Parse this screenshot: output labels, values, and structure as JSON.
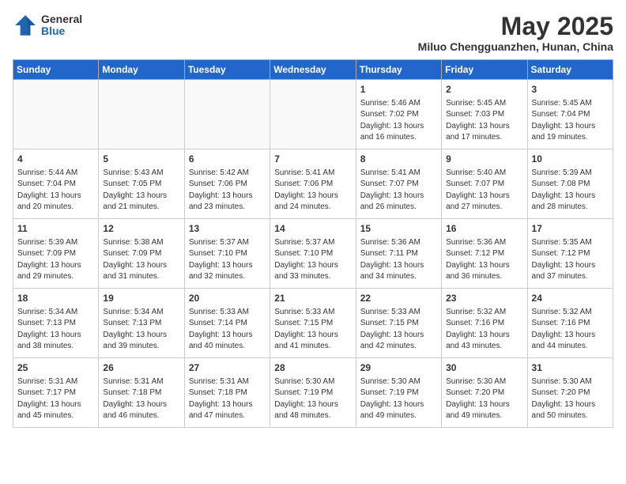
{
  "logo": {
    "general": "General",
    "blue": "Blue"
  },
  "title": "May 2025",
  "subtitle": "Miluo Chengguanzhen, Hunan, China",
  "days_of_week": [
    "Sunday",
    "Monday",
    "Tuesday",
    "Wednesday",
    "Thursday",
    "Friday",
    "Saturday"
  ],
  "weeks": [
    [
      {
        "day": "",
        "info": ""
      },
      {
        "day": "",
        "info": ""
      },
      {
        "day": "",
        "info": ""
      },
      {
        "day": "",
        "info": ""
      },
      {
        "day": "1",
        "info": "Sunrise: 5:46 AM\nSunset: 7:02 PM\nDaylight: 13 hours\nand 16 minutes."
      },
      {
        "day": "2",
        "info": "Sunrise: 5:45 AM\nSunset: 7:03 PM\nDaylight: 13 hours\nand 17 minutes."
      },
      {
        "day": "3",
        "info": "Sunrise: 5:45 AM\nSunset: 7:04 PM\nDaylight: 13 hours\nand 19 minutes."
      }
    ],
    [
      {
        "day": "4",
        "info": "Sunrise: 5:44 AM\nSunset: 7:04 PM\nDaylight: 13 hours\nand 20 minutes."
      },
      {
        "day": "5",
        "info": "Sunrise: 5:43 AM\nSunset: 7:05 PM\nDaylight: 13 hours\nand 21 minutes."
      },
      {
        "day": "6",
        "info": "Sunrise: 5:42 AM\nSunset: 7:06 PM\nDaylight: 13 hours\nand 23 minutes."
      },
      {
        "day": "7",
        "info": "Sunrise: 5:41 AM\nSunset: 7:06 PM\nDaylight: 13 hours\nand 24 minutes."
      },
      {
        "day": "8",
        "info": "Sunrise: 5:41 AM\nSunset: 7:07 PM\nDaylight: 13 hours\nand 26 minutes."
      },
      {
        "day": "9",
        "info": "Sunrise: 5:40 AM\nSunset: 7:07 PM\nDaylight: 13 hours\nand 27 minutes."
      },
      {
        "day": "10",
        "info": "Sunrise: 5:39 AM\nSunset: 7:08 PM\nDaylight: 13 hours\nand 28 minutes."
      }
    ],
    [
      {
        "day": "11",
        "info": "Sunrise: 5:39 AM\nSunset: 7:09 PM\nDaylight: 13 hours\nand 29 minutes."
      },
      {
        "day": "12",
        "info": "Sunrise: 5:38 AM\nSunset: 7:09 PM\nDaylight: 13 hours\nand 31 minutes."
      },
      {
        "day": "13",
        "info": "Sunrise: 5:37 AM\nSunset: 7:10 PM\nDaylight: 13 hours\nand 32 minutes."
      },
      {
        "day": "14",
        "info": "Sunrise: 5:37 AM\nSunset: 7:10 PM\nDaylight: 13 hours\nand 33 minutes."
      },
      {
        "day": "15",
        "info": "Sunrise: 5:36 AM\nSunset: 7:11 PM\nDaylight: 13 hours\nand 34 minutes."
      },
      {
        "day": "16",
        "info": "Sunrise: 5:36 AM\nSunset: 7:12 PM\nDaylight: 13 hours\nand 36 minutes."
      },
      {
        "day": "17",
        "info": "Sunrise: 5:35 AM\nSunset: 7:12 PM\nDaylight: 13 hours\nand 37 minutes."
      }
    ],
    [
      {
        "day": "18",
        "info": "Sunrise: 5:34 AM\nSunset: 7:13 PM\nDaylight: 13 hours\nand 38 minutes."
      },
      {
        "day": "19",
        "info": "Sunrise: 5:34 AM\nSunset: 7:13 PM\nDaylight: 13 hours\nand 39 minutes."
      },
      {
        "day": "20",
        "info": "Sunrise: 5:33 AM\nSunset: 7:14 PM\nDaylight: 13 hours\nand 40 minutes."
      },
      {
        "day": "21",
        "info": "Sunrise: 5:33 AM\nSunset: 7:15 PM\nDaylight: 13 hours\nand 41 minutes."
      },
      {
        "day": "22",
        "info": "Sunrise: 5:33 AM\nSunset: 7:15 PM\nDaylight: 13 hours\nand 42 minutes."
      },
      {
        "day": "23",
        "info": "Sunrise: 5:32 AM\nSunset: 7:16 PM\nDaylight: 13 hours\nand 43 minutes."
      },
      {
        "day": "24",
        "info": "Sunrise: 5:32 AM\nSunset: 7:16 PM\nDaylight: 13 hours\nand 44 minutes."
      }
    ],
    [
      {
        "day": "25",
        "info": "Sunrise: 5:31 AM\nSunset: 7:17 PM\nDaylight: 13 hours\nand 45 minutes."
      },
      {
        "day": "26",
        "info": "Sunrise: 5:31 AM\nSunset: 7:18 PM\nDaylight: 13 hours\nand 46 minutes."
      },
      {
        "day": "27",
        "info": "Sunrise: 5:31 AM\nSunset: 7:18 PM\nDaylight: 13 hours\nand 47 minutes."
      },
      {
        "day": "28",
        "info": "Sunrise: 5:30 AM\nSunset: 7:19 PM\nDaylight: 13 hours\nand 48 minutes."
      },
      {
        "day": "29",
        "info": "Sunrise: 5:30 AM\nSunset: 7:19 PM\nDaylight: 13 hours\nand 49 minutes."
      },
      {
        "day": "30",
        "info": "Sunrise: 5:30 AM\nSunset: 7:20 PM\nDaylight: 13 hours\nand 49 minutes."
      },
      {
        "day": "31",
        "info": "Sunrise: 5:30 AM\nSunset: 7:20 PM\nDaylight: 13 hours\nand 50 minutes."
      }
    ]
  ]
}
